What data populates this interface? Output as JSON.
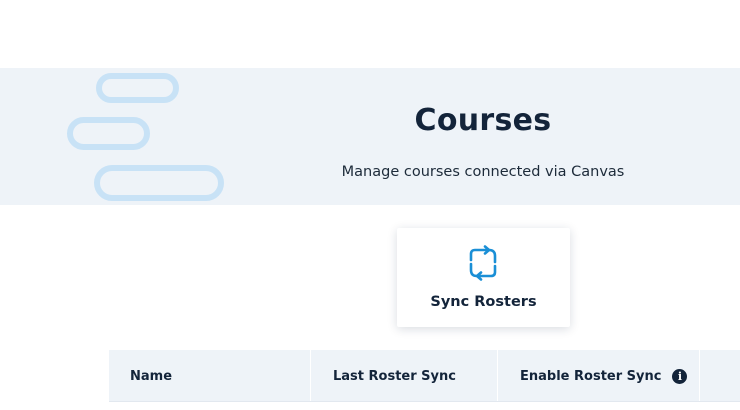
{
  "hero": {
    "title": "Courses",
    "subtitle": "Manage courses connected via Canvas",
    "background": "#eef3f8",
    "decoration_color": "#c8e2f6"
  },
  "sync_card": {
    "label": "Sync Rosters",
    "icon": "sync-icon",
    "icon_color": "#1a8fd6"
  },
  "table": {
    "columns": [
      {
        "label": "Name"
      },
      {
        "label": "Last Roster Sync"
      },
      {
        "label": "Enable Roster Sync",
        "icon": "info-icon"
      },
      {
        "label": ""
      }
    ],
    "header_background": "#eef3f8"
  }
}
